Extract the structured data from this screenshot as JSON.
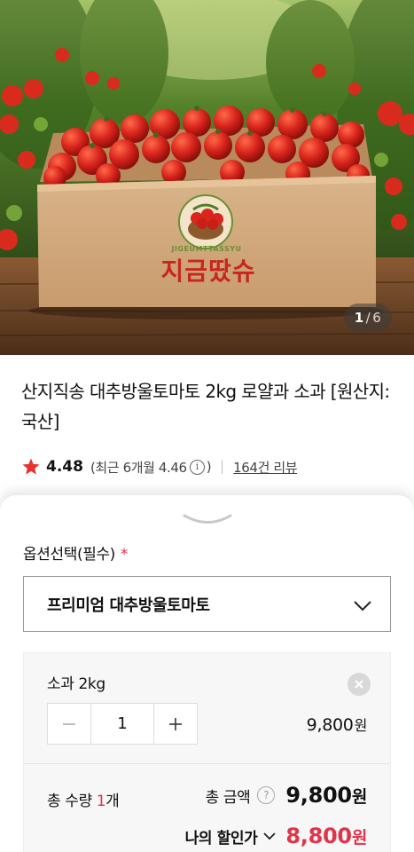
{
  "product_image": {
    "counter_current": "1",
    "counter_separator": "/",
    "counter_total": "6",
    "box_logo_arc_text": "JIGEUMTTASSYU",
    "box_logo_text": "지금땄슈"
  },
  "product": {
    "title": "산지직송 대추방울토마토 2kg 로얄과 소과 [원산지:국산]",
    "rating": "4.48",
    "recent_rating_text": "(최근 6개월 4.46",
    "recent_rating_close": ")",
    "info_icon_glyph": "i",
    "review_link": "164건 리뷰"
  },
  "option_sheet": {
    "option_label": "옵션선택(필수)",
    "required_mark": "*",
    "selected_option": "프리미엄 대추방울토마토",
    "item": {
      "name": "소과 2kg",
      "quantity": "1",
      "price": "9,800",
      "currency": "원"
    },
    "summary": {
      "qty_prefix": "총 수량 ",
      "qty_value": "1",
      "qty_suffix": "개",
      "total_label": "총 금액",
      "help_glyph": "?",
      "total_amount": "9,800",
      "total_currency": "원",
      "my_discount_label": "나의 할인가",
      "discount_price": "8,800",
      "discount_currency": "원"
    }
  },
  "colors": {
    "accent_red": "#e0344a",
    "star": "#e8342e",
    "tomato": "#d9251c"
  },
  "icons": [
    "star-icon",
    "info-icon",
    "sheet-handle-icon",
    "chevron-down-icon",
    "close-icon",
    "minus-icon",
    "plus-icon",
    "help-icon"
  ]
}
